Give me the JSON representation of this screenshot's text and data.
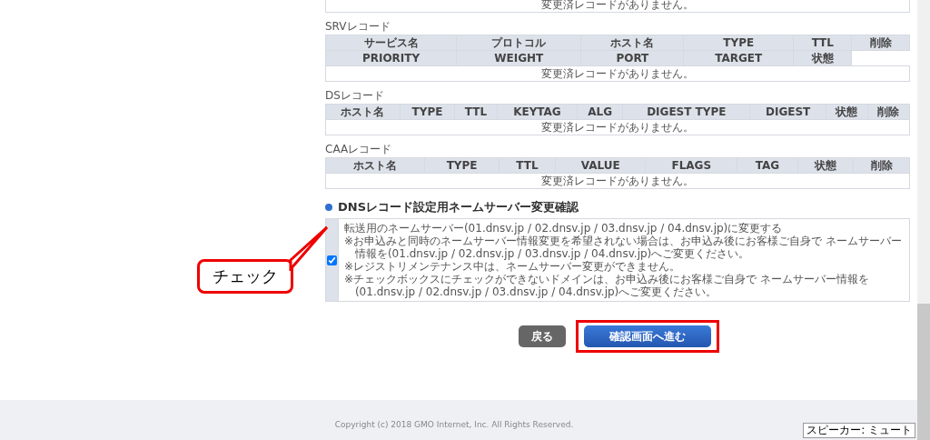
{
  "top_table": {
    "empty_message": "変更済レコードがありません。"
  },
  "record_tables": [
    {
      "title": "SRVレコード",
      "header_rows": [
        [
          "サービス名",
          "プロトコル",
          "ホスト名",
          "TYPE",
          "TTL",
          "削除"
        ],
        [
          "PRIORITY",
          "WEIGHT",
          "PORT",
          "TARGET",
          "状態"
        ]
      ],
      "empty_message": "変更済レコードがありません。"
    },
    {
      "title": "DSレコード",
      "header_rows": [
        [
          "ホスト名",
          "TYPE",
          "TTL",
          "KEYTAG",
          "ALG",
          "DIGEST TYPE",
          "DIGEST",
          "状態",
          "削除"
        ]
      ],
      "empty_message": "変更済レコードがありません。"
    },
    {
      "title": "CAAレコード",
      "header_rows": [
        [
          "ホスト名",
          "TYPE",
          "TTL",
          "VALUE",
          "FLAGS",
          "TAG",
          "状態",
          "削除"
        ]
      ],
      "empty_message": "変更済レコードがありません。"
    }
  ],
  "nameserver_section": {
    "title": "DNSレコード設定用ネームサーバー変更確認",
    "checked": true,
    "lines": [
      "転送用のネームサーバー(01.dnsv.jp / 02.dnsv.jp / 03.dnsv.jp / 04.dnsv.jp)に変更する",
      "※お申込みと同時のネームサーバー情報変更を希望されない場合は、お申込み後にお客様ご自身で ネームサーバー情報を(01.dnsv.jp / 02.dnsv.jp / 03.dnsv.jp / 04.dnsv.jp)へご変更ください。",
      "※レジストリメンテナンス中は、ネームサーバー変更ができません。",
      "※チェックボックスにチェックができないドメインは、お申込み後にお客様ご自身で ネームサーバー情報を(01.dnsv.jp / 02.dnsv.jp / 03.dnsv.jp / 04.dnsv.jp)へご変更ください。"
    ]
  },
  "annotation": {
    "label": "チェック"
  },
  "buttons": [
    {
      "label": "戻る",
      "kind": "back",
      "highlighted": false
    },
    {
      "label": "確認画面へ進む",
      "kind": "primary",
      "highlighted": true
    }
  ],
  "footer": {
    "copyright": "Copyright (c) 2018 GMO Internet, Inc. All Rights Reserved."
  },
  "tooltip": {
    "text": "スピーカー: ミュート"
  }
}
